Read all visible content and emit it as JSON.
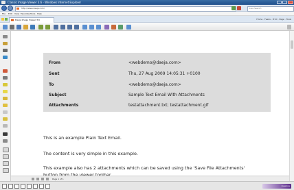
{
  "window": {
    "title": "Classic Image Viewer 3.6 - Windows Internet Explorer"
  },
  "address_bar": {
    "url": "http://www.daeja.com/",
    "search_placeholder": "Live Search"
  },
  "menu": {
    "items": [
      "File",
      "Edit",
      "View",
      "Favorites",
      "Tools",
      "Help"
    ]
  },
  "tab": {
    "label": "Daeja Image Viewer 3.6",
    "commands": "Home · Feeds · Print · Page · Tools"
  },
  "email_header": {
    "rows": [
      {
        "label": "From",
        "value": "<webdemo@daeja.com>"
      },
      {
        "label": "Sent",
        "value": "Thu, 27 Aug 2009 14:05:31 +0100"
      },
      {
        "label": "To",
        "value": "<webdemo@daeja.com>"
      },
      {
        "label": "Subject",
        "value": "Sample Text Email With Attachments"
      },
      {
        "label": "Attachments",
        "value": "testattachment.txt; testattachment.gif"
      }
    ]
  },
  "email_body": {
    "lines": [
      "This is an example Plain Text Email.",
      "The content is very simple in this example.",
      "This example also has 2 attachments which can be saved using the 'Save File Attachments'",
      "button from the viewer toolbar."
    ]
  },
  "page_nav": {
    "label": "Page 1 of 1"
  },
  "status": {
    "brand": "viewone"
  },
  "colors": {
    "title_bar": "#1f4f8c",
    "header_box": "#dcdcdc",
    "accent_nav": "#3d6fb6",
    "brand_purple": "#5a2a8a"
  }
}
